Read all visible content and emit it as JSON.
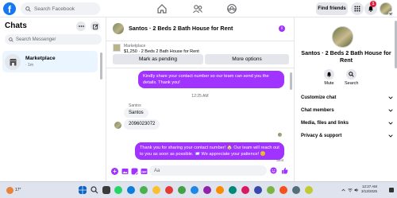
{
  "topbar": {
    "logo": "f",
    "search_placeholder": "Search Facebook",
    "find_friends": "Find friends",
    "notification_count": "1"
  },
  "left": {
    "title": "Chats",
    "search_placeholder": "Search Messenger",
    "conversation": {
      "name": "Marketplace",
      "time": "· 1m"
    }
  },
  "chat": {
    "title": "Santos · 2 Beds 2 Bath House for Rent",
    "listing_category": "Marketplace",
    "listing_price": "$1,250 · 2 Beds 2 Bath House for Rent",
    "pending_label": "Mark as pending",
    "more_label": "More options",
    "messages": [
      {
        "from": "me",
        "text": "Kindly share your contact number so our team can send you the details. Thank you!"
      },
      {
        "from": "them",
        "text": "Santos"
      },
      {
        "from": "them",
        "text": "2096023072"
      },
      {
        "from": "me",
        "text": "Thank you for sharing your contact number! 🏠 Our team will reach out to you as soon as possible. 📨 We appreciate your patience! 😊"
      }
    ],
    "timestamp": "12:25 AM",
    "sender_name": "Santos",
    "sent_label": "Sent",
    "composer_placeholder": "Aa"
  },
  "right": {
    "title": "Santos · 2 Beds 2 Bath House for Rent",
    "mute_label": "Mute",
    "search_label": "Search",
    "sections": [
      "Customize chat",
      "Chat members",
      "Media, files and links",
      "Privacy & support"
    ]
  },
  "taskbar": {
    "time": "12:27 AM",
    "date": "3/13/2025",
    "weather": "17°"
  },
  "colors": {
    "accent": "#a033ff",
    "facebook_blue": "#1877f2",
    "badge_red": "#e41e3f"
  }
}
